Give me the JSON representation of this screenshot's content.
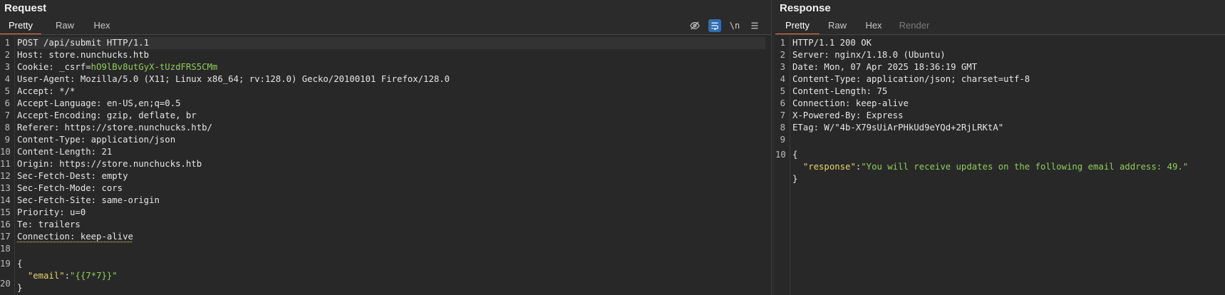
{
  "request": {
    "title": "Request",
    "tabs": [
      {
        "label": "Pretty"
      },
      {
        "label": "Raw"
      },
      {
        "label": "Hex"
      }
    ],
    "icons": [
      "eye-slash-icon",
      "wrap-lines-icon",
      "newline-icon",
      "menu-icon"
    ],
    "newline_label": "\\n",
    "lines": [
      "POST /api/submit HTTP/1.1",
      "Host: store.nunchucks.htb",
      "Cookie: _csrf=",
      "User-Agent: Mozilla/5.0 (X11; Linux x86_64; rv:128.0) Gecko/20100101 Firefox/128.0",
      "Accept: */*",
      "Accept-Language: en-US,en;q=0.5",
      "Accept-Encoding: gzip, deflate, br",
      "Referer: https://store.nunchucks.htb/",
      "Content-Type: application/json",
      "Content-Length: 21",
      "Origin: https://store.nunchucks.htb",
      "Sec-Fetch-Dest: empty",
      "Sec-Fetch-Mode: cors",
      "Sec-Fetch-Site: same-origin",
      "Priority: u=0",
      "Te: trailers",
      "Connection: keep-alive",
      "",
      "{",
      "}"
    ],
    "cookie_value": "hO9lBv8utGyX-tUzdFRS5CMm",
    "json_key": "\"email\"",
    "json_sep": ":",
    "json_value": "\"{{7*7}}\"",
    "line_numbers": [
      "1",
      "2",
      "3",
      "4",
      "5",
      "6",
      "7",
      "8",
      "9",
      "10",
      "11",
      "12",
      "13",
      "14",
      "15",
      "16",
      "17",
      "18",
      "19",
      "20"
    ]
  },
  "response": {
    "title": "Response",
    "tabs": [
      {
        "label": "Pretty"
      },
      {
        "label": "Raw"
      },
      {
        "label": "Hex"
      },
      {
        "label": "Render"
      }
    ],
    "lines": [
      "HTTP/1.1 200 OK",
      "Server: nginx/1.18.0 (Ubuntu)",
      "Date: Mon, 07 Apr 2025 18:36:19 GMT",
      "Content-Type: application/json; charset=utf-8",
      "Content-Length: 75",
      "Connection: keep-alive",
      "X-Powered-By: Express",
      "ETag: W/\"4b-X79sUiArPHkUd9eYQd+2RjLRKtA\"",
      "",
      "{",
      "}"
    ],
    "json_key": "\"response\"",
    "json_sep": ":",
    "json_value": "\"You will receive updates on the following email address: 49.\"",
    "line_numbers": [
      "1",
      "2",
      "3",
      "4",
      "5",
      "6",
      "7",
      "8",
      "9",
      "10"
    ]
  }
}
